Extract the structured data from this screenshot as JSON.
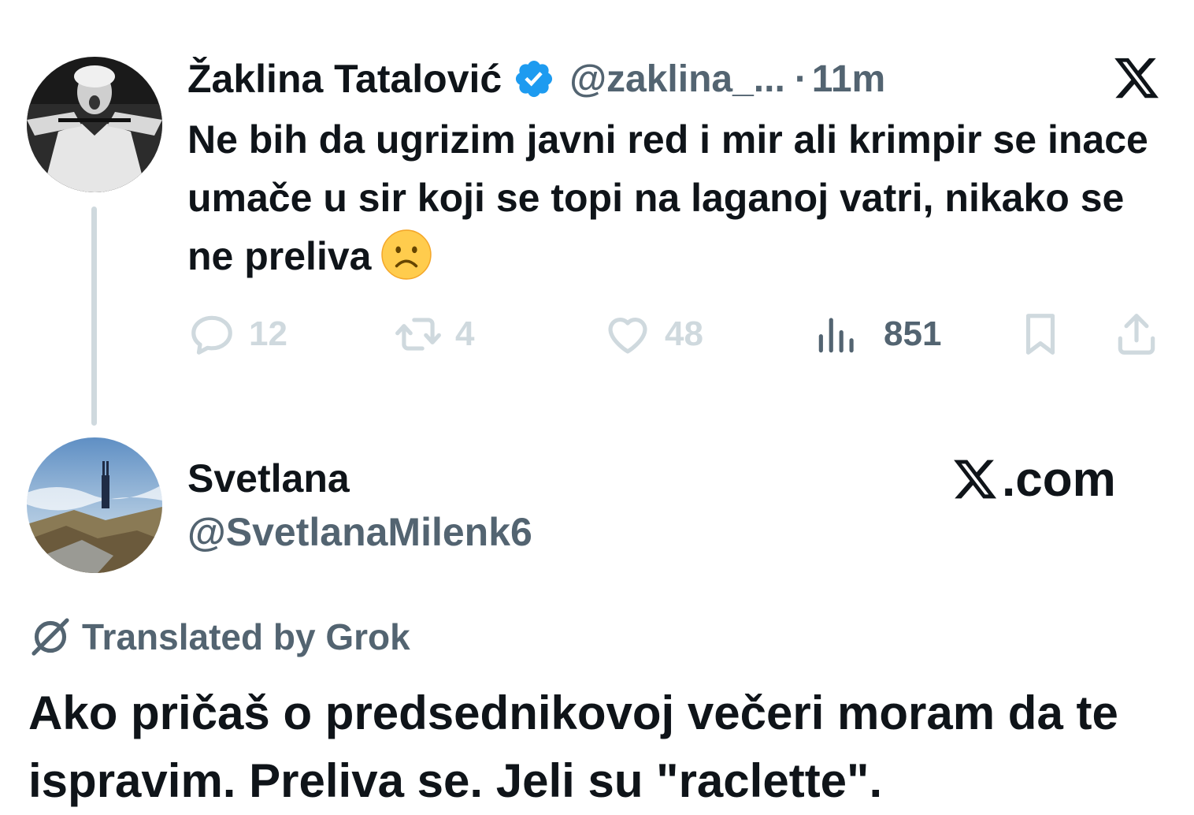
{
  "parent_tweet": {
    "display_name": "Žaklina Tatalović",
    "handle": "@zaklina_...",
    "separator": "·",
    "timestamp": "11m",
    "text": "Ne bih da ugrizim javni red i mir ali krimpir se inace umače u sir koji se topi na laganoj vatri, nikako se ne preliva",
    "emoji": "frowning-face",
    "actions": {
      "replies": "12",
      "retweets": "4",
      "likes": "48",
      "views": "851"
    },
    "icons": {
      "verified": "verified-badge-icon",
      "platform": "x-logo-icon",
      "reply": "reply-icon",
      "retweet": "retweet-icon",
      "like": "heart-icon",
      "views": "views-chart-icon",
      "bookmark": "bookmark-icon",
      "share": "share-icon"
    }
  },
  "reply": {
    "display_name": "Svetlana",
    "handle": "@SvetlanaMilenk6",
    "translation_label": "Translated by Grok",
    "text": "Ako pričaš o predsednikovoj večeri moram da te ispravim. Preliva se. Jeli su \"raclette\"."
  },
  "brand": {
    "text": ".com"
  },
  "colors": {
    "primary_text": "#0f1419",
    "secondary_text": "#536471",
    "muted": "#cfd9de",
    "verified_blue": "#1d9bf0",
    "background": "#ffffff"
  }
}
